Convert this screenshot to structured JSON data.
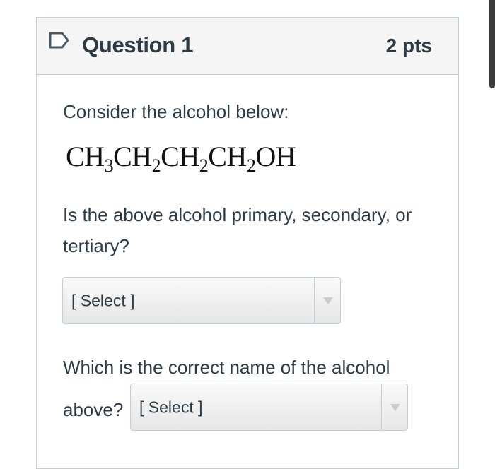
{
  "question": {
    "title": "Question 1",
    "points": "2 pts"
  },
  "content": {
    "intro": "Consider the alcohol below:",
    "formula_parts": [
      "CH",
      "3",
      "CH",
      "2",
      "CH",
      "2",
      "CH",
      "2",
      "OH"
    ],
    "q1_text": "Is the above alcohol primary, secondary, or tertiary?",
    "q1_select_value": "[ Select ]",
    "q2_text_line1": "Which is the correct name of the alcohol",
    "q2_text_line2": "above?",
    "q2_select_value": "[ Select ]"
  },
  "icons": {
    "flag": "bookmark-flag-icon",
    "dropdown": "caret-down-icon"
  }
}
